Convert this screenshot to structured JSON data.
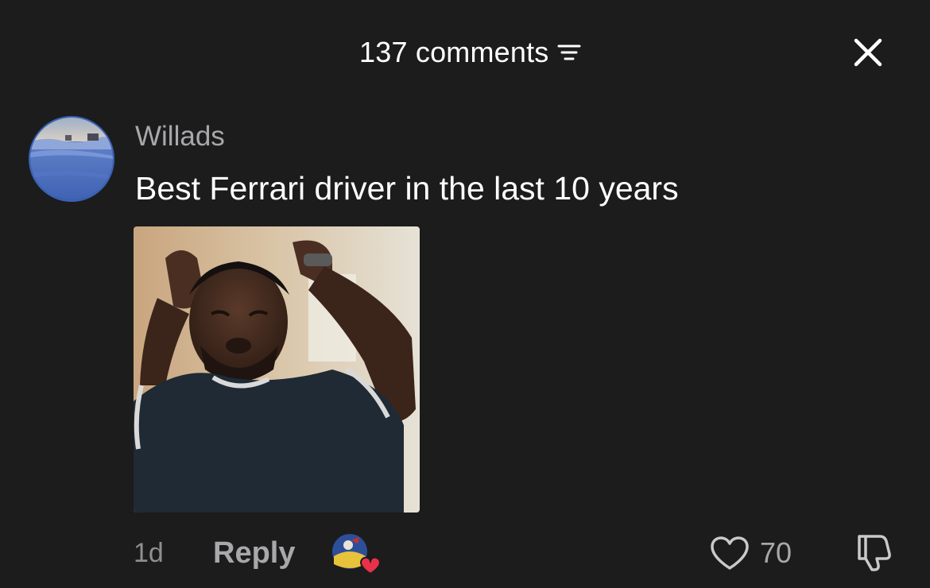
{
  "header": {
    "comment_count_label": "137 comments",
    "sort_icon": "sort-lines-icon",
    "close_icon": "close-icon"
  },
  "comment": {
    "username": "Willads",
    "text": "Best Ferrari driver in the last 10 years",
    "avatar_icon": "avatar-snow-landscape",
    "attachment": "crying-man-gif",
    "time": "1d",
    "reply_label": "Reply",
    "reactor_icon": "creator-liked-avatar",
    "like_icon": "heart-icon",
    "like_count": "70",
    "dislike_icon": "thumbs-down-icon"
  },
  "colors": {
    "background": "#1c1c1d",
    "primary_text": "#ffffff",
    "secondary_text": "#a8a8ab",
    "heart_badge": "#e8314a"
  }
}
